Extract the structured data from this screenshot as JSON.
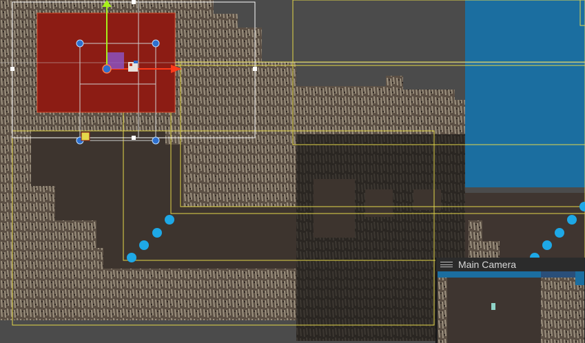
{
  "camera_preview": {
    "title": "Main Camera"
  },
  "colors": {
    "water": "#1b6ea0",
    "selection_fill": "#8c1c14",
    "gizmo_x": "#ff3b1b",
    "gizmo_y": "#a6f01a",
    "collider_outline": "#e5d84a",
    "path_point": "#1ea8e6",
    "handle": "#2d6fcf",
    "rect_tool_outline": "#ffffff"
  }
}
